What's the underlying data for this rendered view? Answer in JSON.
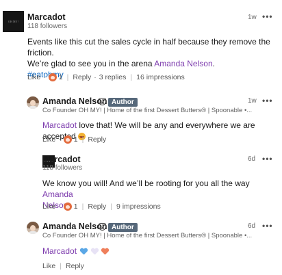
{
  "comment": {
    "logo_text": "OH MY!",
    "author": "Marcadot",
    "followers": "118 followers",
    "time": "1w",
    "more": "•••",
    "text_line1": "Events like this cut the sales cycle in half because they remove the friction.",
    "text_line2_prefix": "We’re glad to see you in the arena ",
    "text_line2_mention": "Amanda Nelson",
    "text_line2_suffix": ".",
    "hashtag": "#eatohmy",
    "like": "Like",
    "reaction_count": "1",
    "reply": "Reply",
    "replies": "3 replies",
    "impressions": "16 impressions"
  },
  "replies": [
    {
      "author": "Amanda Nelson",
      "badge": "Author",
      "headline": "Co Founder OH MY! | Home of the first Dessert Butters® | Spoonable •...",
      "time": "1w",
      "more": "•••",
      "mention": "Marcadot",
      "text": " love that! We will be any and everywhere we are accepted ",
      "like": "Like",
      "reaction_count": "1",
      "reply": "Reply"
    },
    {
      "logo_text": "OH MY!",
      "author": "Marcadot",
      "followers": "118 followers",
      "time": "6d",
      "more": "•••",
      "text_line1_prefix": "We know you will! And we’ll be rooting for you all the way ",
      "text_line1_mention": "Amanda",
      "text_line2_mention": "Nelson",
      "like": "Like",
      "reaction_count": "1",
      "reply": "Reply",
      "impressions": "9 impressions"
    },
    {
      "author": "Amanda Nelson",
      "badge": "Author",
      "headline": "Co Founder OH MY! | Home of the first Dessert Butters® | Spoonable •...",
      "time": "6d",
      "more": "•••",
      "mention": "Marcadot",
      "like": "Like",
      "reply": "Reply"
    }
  ],
  "colors": {
    "mention": "#7c3aad",
    "hashtag": "#0a66c2",
    "author_badge": "#56687a",
    "heart_blue": "#5aa7e6",
    "heart_white": "#e7e2f5",
    "heart_orange": "#ef7f5b"
  },
  "icons": {
    "reaction": "celebrate-reaction-icon",
    "verified": "verified-shield-icon",
    "more": "more-options-icon"
  }
}
